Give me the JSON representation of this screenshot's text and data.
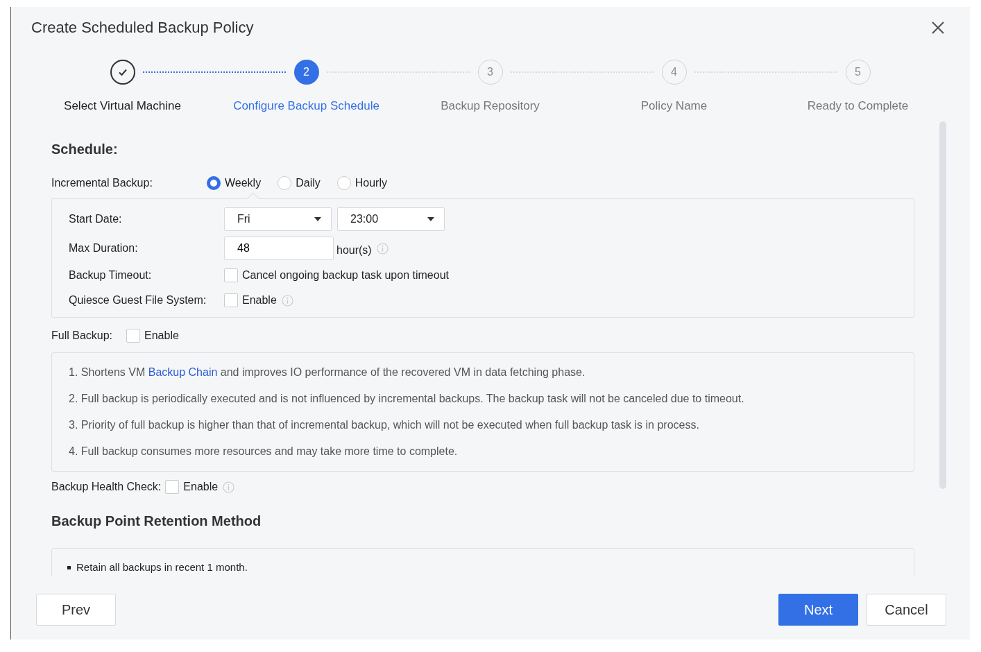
{
  "dialog": {
    "title": "Create Scheduled Backup Policy"
  },
  "steps": [
    {
      "label": "Select Virtual Machine",
      "completed": true,
      "selected": false
    },
    {
      "label": "Configure Backup Schedule",
      "number": "2",
      "completed": false,
      "selected": true
    },
    {
      "label": "Backup Repository",
      "number": "3",
      "completed": false,
      "selected": false
    },
    {
      "label": "Policy Name",
      "number": "4",
      "completed": false,
      "selected": false
    },
    {
      "label": "Ready to Complete",
      "number": "5",
      "completed": false,
      "selected": false
    }
  ],
  "schedule": {
    "heading": "Schedule:",
    "incremental": {
      "label": "Incremental Backup:",
      "options": [
        {
          "label": "Weekly",
          "selected": true
        },
        {
          "label": "Daily",
          "selected": false
        },
        {
          "label": "Hourly",
          "selected": false
        }
      ]
    },
    "start_date": {
      "label": "Start Date:",
      "day": "Fri",
      "time": "23:00"
    },
    "max_duration": {
      "label": "Max Duration:",
      "value": "48",
      "unit": "hour(s)"
    },
    "backup_timeout": {
      "label": "Backup Timeout:",
      "option": "Cancel ongoing backup task upon timeout",
      "checked": false
    },
    "quiesce": {
      "label": "Quiesce Guest File System:",
      "option": "Enable",
      "checked": false
    },
    "full_backup": {
      "label": "Full Backup:",
      "option": "Enable",
      "checked": false
    },
    "notes": [
      {
        "before": "1. Shortens VM ",
        "link": "Backup Chain",
        "after": " and improves IO performance of the recovered VM in data fetching phase."
      },
      {
        "before": "2. Full backup is periodically executed and is not influenced by incremental backups. The backup task will not be canceled due to timeout."
      },
      {
        "before": "3. Priority of full backup is higher than that of incremental backup, which will not be executed when full backup task is in process."
      },
      {
        "before": "4. Full backup consumes more resources and may take more time to complete."
      }
    ],
    "health_check": {
      "label": "Backup Health Check:",
      "option": "Enable",
      "checked": false
    }
  },
  "retention": {
    "heading": "Backup Point Retention Method",
    "items": [
      "Retain all backups in recent 1 month."
    ]
  },
  "footer": {
    "prev": "Prev",
    "next": "Next",
    "cancel": "Cancel"
  }
}
